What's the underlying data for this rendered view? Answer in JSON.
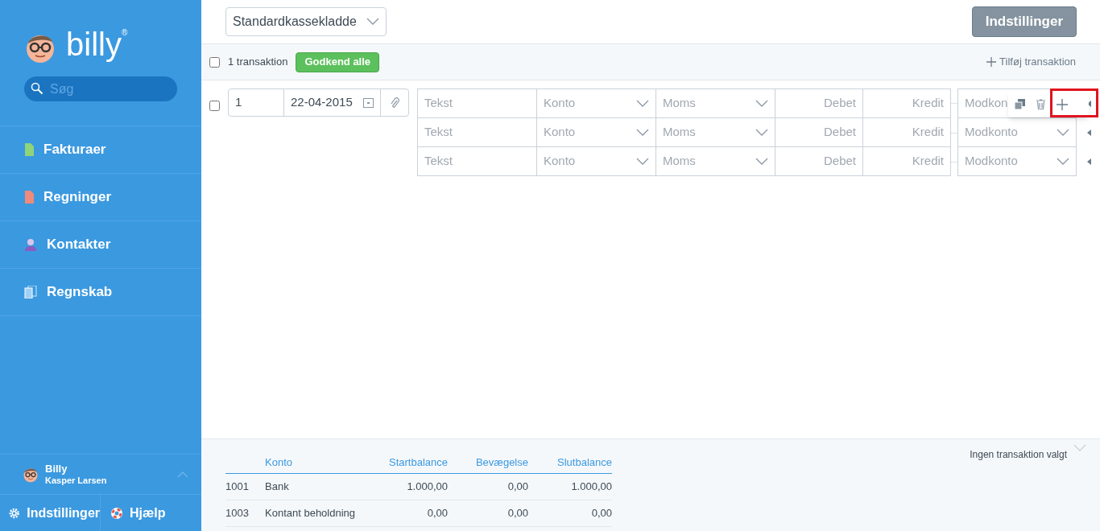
{
  "sidebar": {
    "logo": "billy",
    "logo_mark": "®",
    "search": {
      "placeholder": "Søg"
    },
    "items": [
      {
        "label": "Fakturaer",
        "color": "#8fd37a",
        "kind": "doc"
      },
      {
        "label": "Regninger",
        "color": "#f08a7a",
        "kind": "doc"
      },
      {
        "label": "Kontakter",
        "color": "#8a5cc0",
        "kind": "person"
      },
      {
        "label": "Regnskab",
        "color": "#9fd0f5",
        "kind": "docs"
      }
    ],
    "user": {
      "name": "Billy",
      "org": "Kasper Larsen"
    },
    "footer": [
      "Indstillinger",
      "Hjælp"
    ]
  },
  "header": {
    "journal": "Standardkassekladde",
    "settings_button": "Indstillinger"
  },
  "toolbar": {
    "checked": false,
    "count": "1 transaktion",
    "approve_button": "Godkend alle",
    "add_link": "Tilføj transaktion"
  },
  "transaction": {
    "checked": false,
    "number": "1",
    "date": "22-04-2015",
    "lines": [
      {
        "text": "Tekst",
        "account": "Konto",
        "vat": "Moms",
        "debit": "Debet",
        "credit": "Kredit",
        "contra": "Modkon",
        "popover": true
      },
      {
        "text": "Tekst",
        "account": "Konto",
        "vat": "Moms",
        "debit": "Debet",
        "credit": "Kredit",
        "contra": "Modkonto",
        "popover": false
      },
      {
        "text": "Tekst",
        "account": "Konto",
        "vat": "Moms",
        "debit": "Debet",
        "credit": "Kredit",
        "contra": "Modkonto",
        "popover": false
      }
    ]
  },
  "balance": {
    "columns": [
      "",
      "Konto",
      "Startbalance",
      "Bevægelse",
      "Slutbalance"
    ],
    "rows": [
      [
        "1001",
        "Bank",
        "1.000,00",
        "0,00",
        "1.000,00"
      ],
      [
        "1003",
        "Kontant beholdning",
        "0,00",
        "0,00",
        "0,00"
      ]
    ],
    "status": "Ingen transaktion valgt"
  }
}
